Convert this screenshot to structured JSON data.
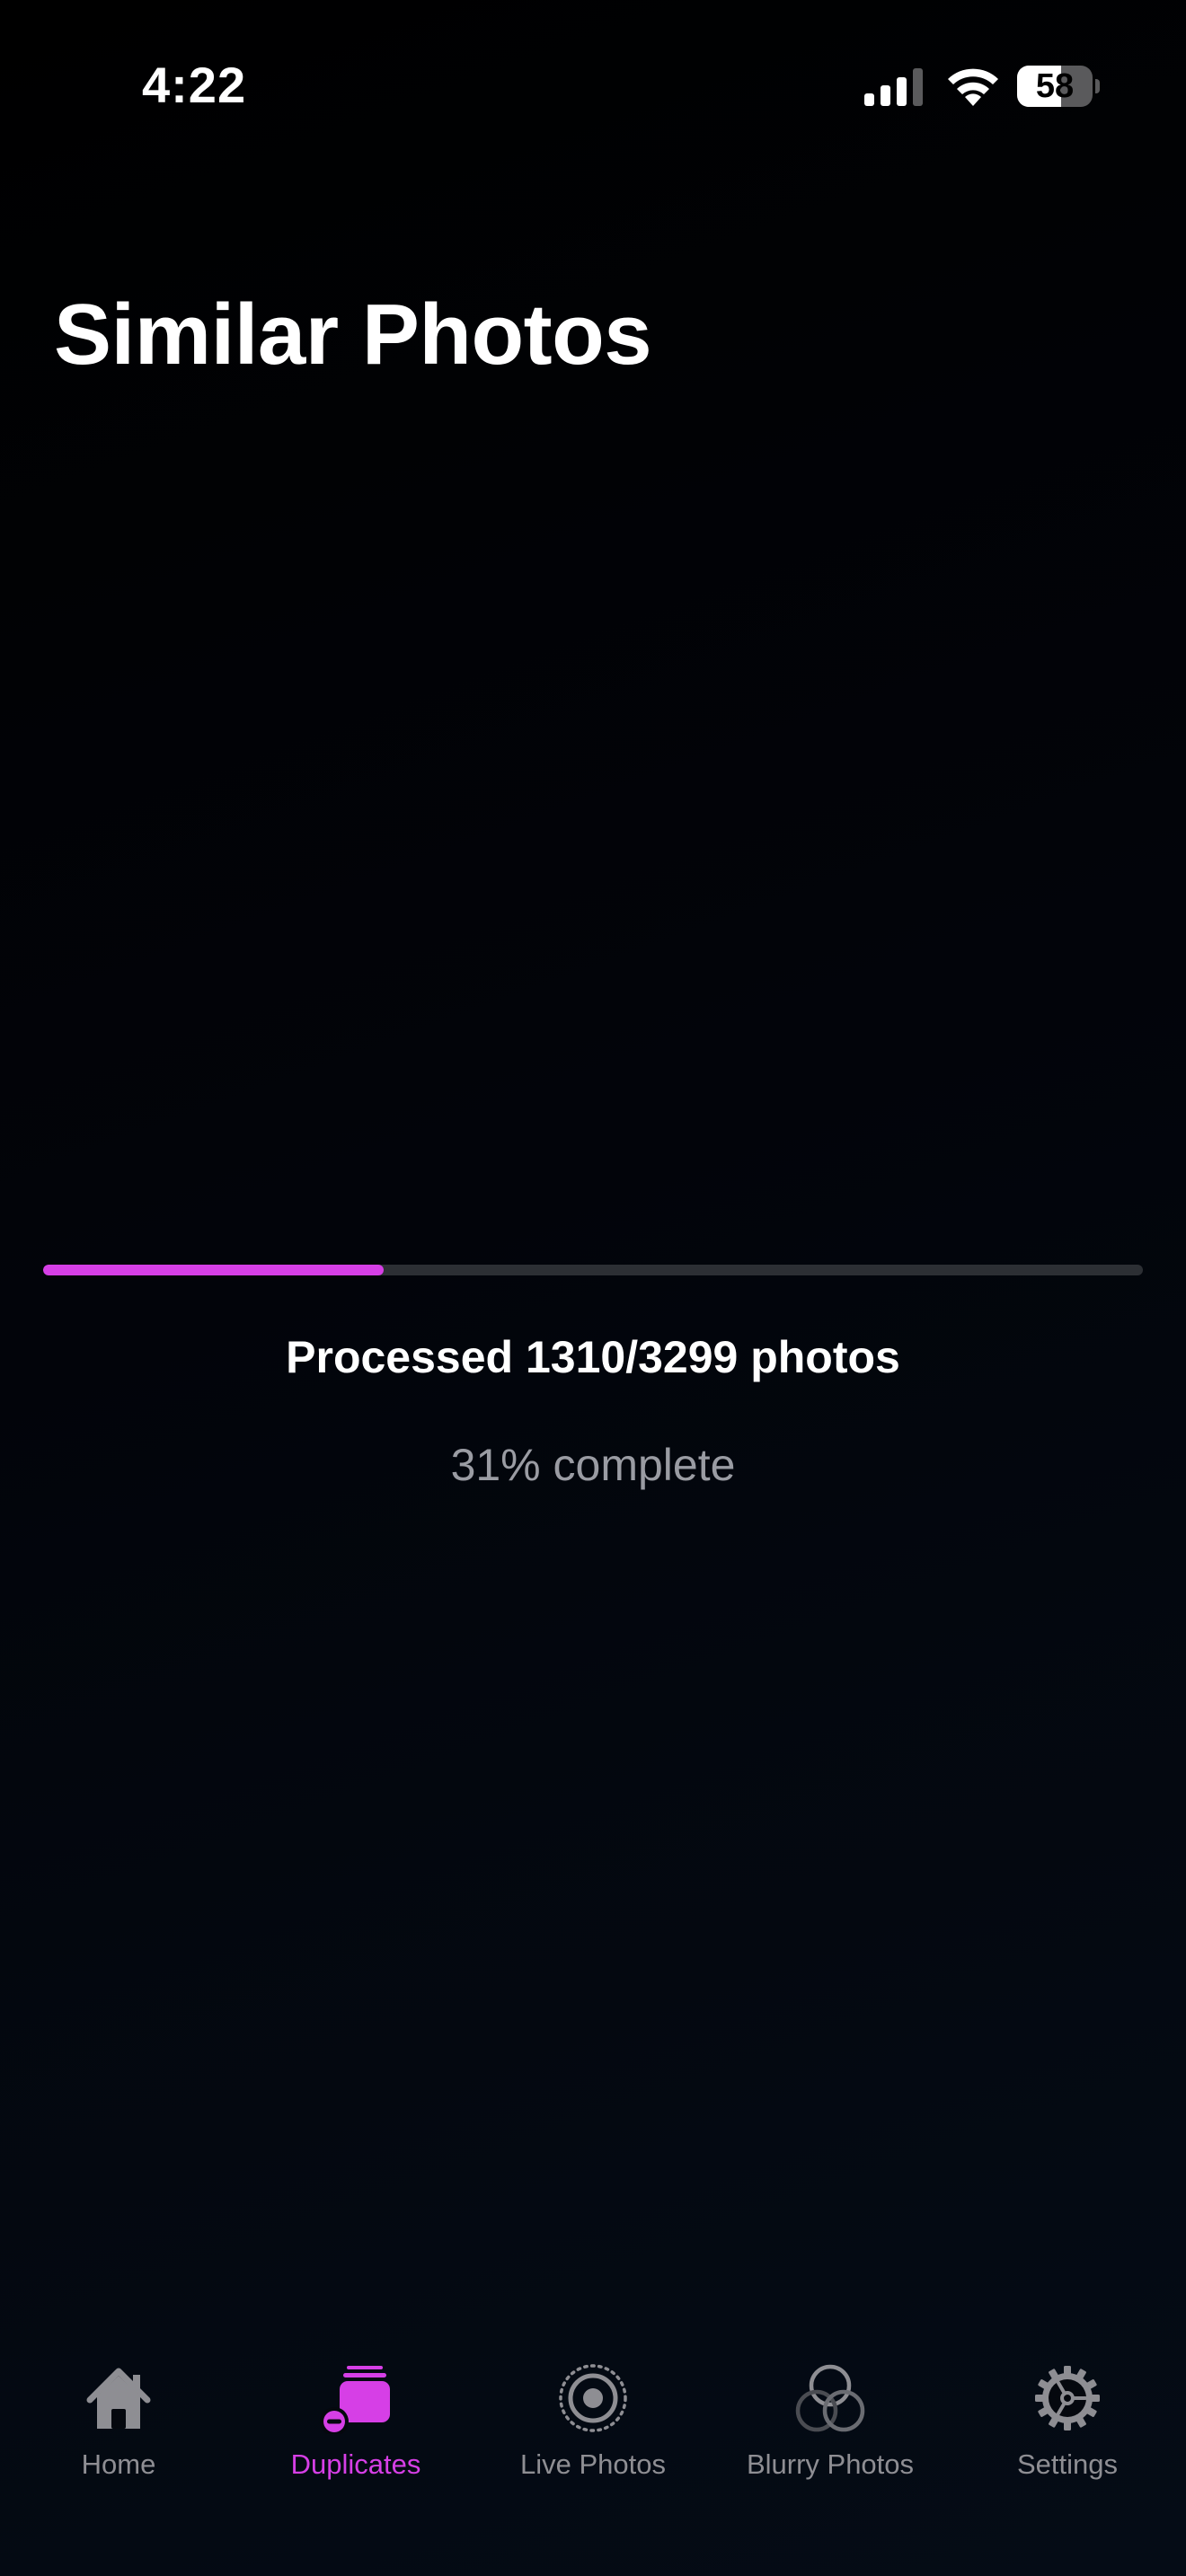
{
  "status_bar": {
    "time": "4:22",
    "battery_level": "58",
    "battery_fraction": 0.58,
    "icons": [
      "cellular-signal-icon",
      "wifi-icon",
      "battery-icon"
    ]
  },
  "page": {
    "title": "Similar Photos"
  },
  "progress": {
    "fraction": 0.31,
    "processed_label": "Processed 1310/3299 photos",
    "percent_label": "31% complete"
  },
  "tab_bar": {
    "active_tab": "duplicates",
    "tabs": [
      {
        "id": "home",
        "label": "Home",
        "icon": "house-icon"
      },
      {
        "id": "duplicates",
        "label": "Duplicates",
        "icon": "duplicates-stack-icon"
      },
      {
        "id": "live",
        "label": "Live Photos",
        "icon": "live-photo-icon"
      },
      {
        "id": "blurry",
        "label": "Blurry Photos",
        "icon": "blurry-circles-icon"
      },
      {
        "id": "settings",
        "label": "Settings",
        "icon": "gear-icon"
      }
    ]
  },
  "colors": {
    "accent": "#d63fe6",
    "inactive": "#8e8e93",
    "track": "#2c2f34",
    "secondary_text": "#9a9ca3",
    "background": "#000000"
  }
}
